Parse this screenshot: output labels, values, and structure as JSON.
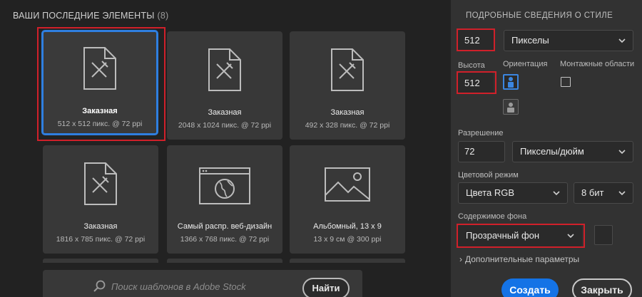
{
  "recent": {
    "title": "ВАШИ ПОСЛЕДНИЕ ЭЛЕМЕНТЫ",
    "count": "(8)",
    "items": [
      {
        "name": "Заказная",
        "meta": "512 x 512 пикс. @ 72 ppi",
        "icon": "document-pencil-icon"
      },
      {
        "name": "Заказная",
        "meta": "2048 x 1024 пикс. @ 72 ppi",
        "icon": "document-pencil-icon"
      },
      {
        "name": "Заказная",
        "meta": "492 x 328 пикс. @ 72 ppi",
        "icon": "document-pencil-icon"
      },
      {
        "name": "Заказная",
        "meta": "1816 x 785 пикс. @ 72 ppi",
        "icon": "document-pencil-icon"
      },
      {
        "name": "Самый распр. веб-дизайн",
        "meta": "1366 x 768 пикс. @ 72 ppi",
        "icon": "web-globe-icon"
      },
      {
        "name": "Альбомный, 13 x 9",
        "meta": "13 x 9 см @ 300 ppi",
        "icon": "landscape-image-icon"
      }
    ]
  },
  "search": {
    "placeholder": "Поиск шаблонов в Adobe Stock",
    "button": "Найти"
  },
  "details": {
    "title": "ПОДРОБНЫЕ СВЕДЕНИЯ О СТИЛЕ",
    "width_value": "512",
    "width_unit": "Пикселы",
    "height_label": "Высота",
    "height_value": "512",
    "orientation_label": "Ориентация",
    "artboards_label": "Монтажные области",
    "resolution_label": "Разрешение",
    "resolution_value": "72",
    "resolution_unit": "Пикселы/дюйм",
    "color_mode_label": "Цветовой режим",
    "color_mode_value": "Цвета RGB",
    "bit_depth_value": "8 бит",
    "background_label": "Содержимое фона",
    "background_value": "Прозрачный фон",
    "advanced_label": "Дополнительные параметры"
  },
  "actions": {
    "create": "Создать",
    "close": "Закрыть"
  },
  "colors": {
    "accent": "#1473e6",
    "highlight_red": "#d0202a",
    "selected_border": "#2f7fe0"
  }
}
